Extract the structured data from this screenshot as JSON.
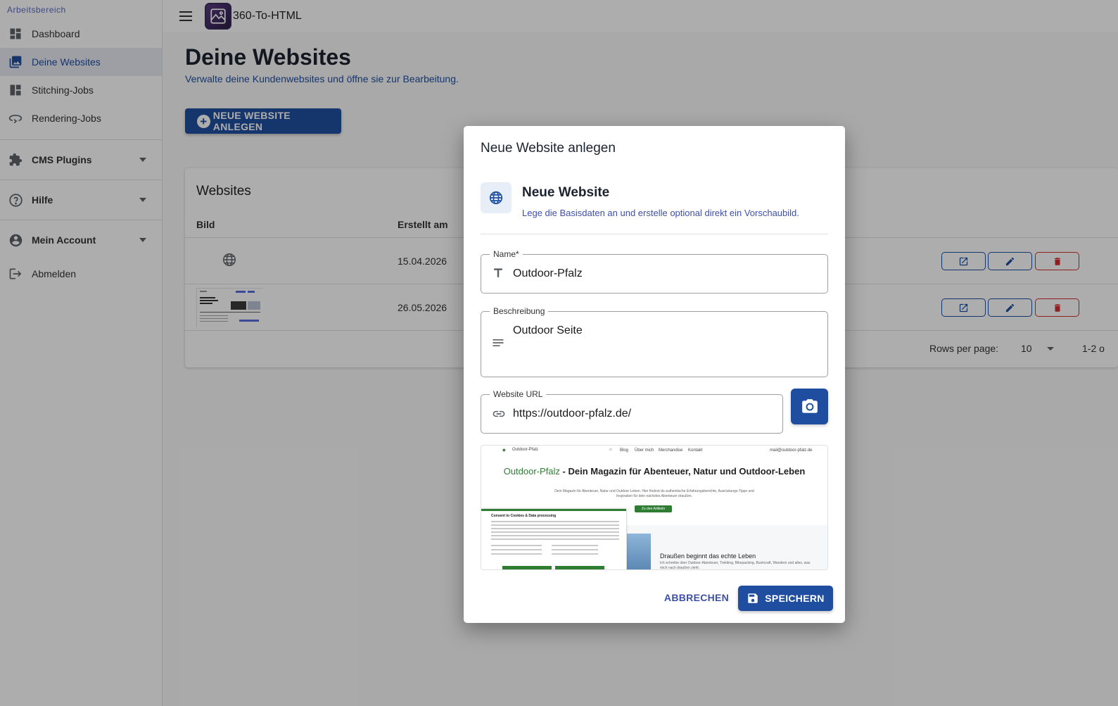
{
  "app": {
    "title": "360-To-HTML"
  },
  "sidebar": {
    "section_label": "Arbeitsbereich",
    "items": [
      {
        "label": "Dashboard",
        "icon": "dashboard-icon"
      },
      {
        "label": "Deine Websites",
        "icon": "photo-library-icon",
        "active": true
      },
      {
        "label": "Stitching-Jobs",
        "icon": "grid-layout-icon"
      },
      {
        "label": "Rendering-Jobs",
        "icon": "rotate-360-icon"
      }
    ],
    "groups": [
      {
        "label": "CMS Plugins",
        "icon": "puzzle-icon"
      },
      {
        "label": "Hilfe",
        "icon": "help-circle-icon"
      },
      {
        "label": "Mein Account",
        "icon": "account-circle-icon"
      }
    ],
    "logout_label": "Abmelden"
  },
  "page": {
    "title": "Deine Websites",
    "subtitle": "Verwalte deine Kundenwebsites und öffne sie zur Bearbeitung.",
    "new_button": "NEUE WEBSITE ANLEGEN"
  },
  "table": {
    "title": "Websites",
    "headers": {
      "image": "Bild",
      "created": "Erstellt am"
    },
    "rows": [
      {
        "created": "15.04.2026",
        "image": "globe-icon"
      },
      {
        "created": "26.05.2026",
        "image": "screenshot-thumbnail"
      }
    ],
    "rows_per_page_label": "Rows per page:",
    "rows_per_page_value": "10",
    "range": "1-2 o"
  },
  "dialog": {
    "title": "Neue Website anlegen",
    "header_title": "Neue Website",
    "header_subtitle": "Lege die Basisdaten an und erstelle optional direkt ein Vorschaubild.",
    "name": {
      "label": "Name*",
      "value": "Outdoor-Pfalz"
    },
    "description": {
      "label": "Beschreibung",
      "value": "Outdoor Seite"
    },
    "url": {
      "label": "Website URL",
      "value": "https://outdoor-pfalz.de/"
    },
    "preview": {
      "brand": "Outdoor-Pfalz",
      "nav": [
        "Blog",
        "Über mich",
        "Merchandise",
        "Kontakt"
      ],
      "email": "mail@outdoor-pfalz.de",
      "headline_brand": "Outdoor-Pfalz",
      "headline_rest": " - Dein Magazin für Abenteuer, Natur und Outdoor-Leben",
      "intro": "Dein Magazin für Abenteuer, Natur und Outdoor-Leben. Hier findest du authentische Erfahrungsberichte, Ausrüstungs-Tipps und Inspiration für dein nächstes Abenteuer draußen.",
      "cta": "Zu den Artikeln",
      "cookie_title": "Consent to Cookies & Data processing",
      "section_title": "Draußen beginnt das echte Leben",
      "section_text": "Ich schreibe über Outdoor-Abenteuer, Trekking, Bikepacking, Bushcraft, Wandern und alles, was mich nach draußen zieht."
    },
    "cancel_label": "ABBRECHEN",
    "save_label": "SPEICHERN"
  },
  "colors": {
    "primary": "#1f4ea1",
    "danger": "#d32f2f",
    "preview_green": "#2e7d32"
  }
}
